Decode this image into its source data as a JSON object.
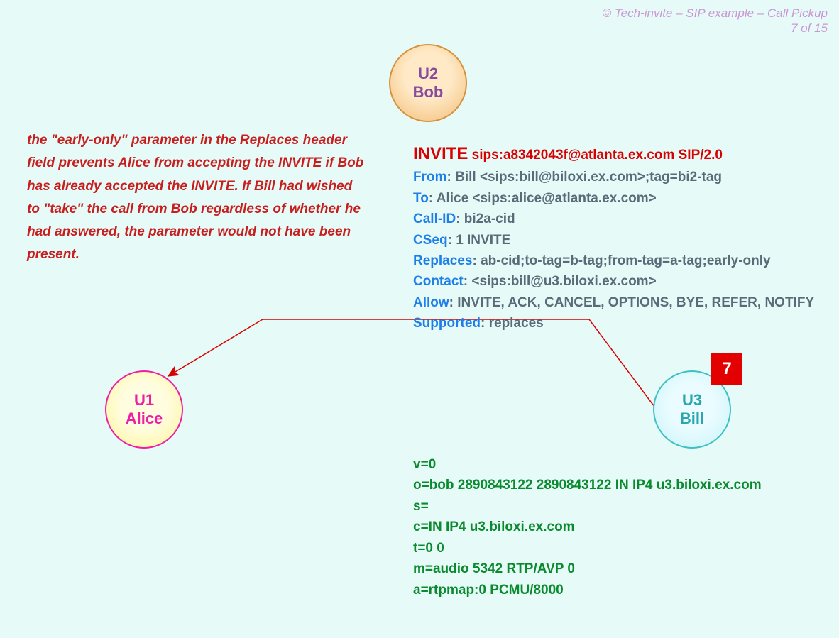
{
  "copyright": {
    "line1": "© Tech-invite – SIP example – Call Pickup",
    "line2": "7 of 15"
  },
  "note": "the \"early-only\" parameter in the Replaces header field prevents Alice from accepting the INVITE if Bob has already accepted the INVITE.  If Bill had wished to \"take\" the call from Bob regardless of whether he had answered, the parameter would not have been present.",
  "nodes": {
    "bob": {
      "ua": "U2",
      "name": "Bob"
    },
    "alice": {
      "ua": "U1",
      "name": "Alice"
    },
    "bill": {
      "ua": "U3",
      "name": "Bill"
    }
  },
  "step": "7",
  "sip": {
    "method": "INVITE",
    "request_uri": "sips:a8342043f@atlanta.ex.com SIP/2.0",
    "headers": {
      "From": {
        "label": "From",
        "value": "Bill <sips:bill@biloxi.ex.com>;tag=bi2-tag"
      },
      "To": {
        "label": "To",
        "value": "Alice <sips:alice@atlanta.ex.com>"
      },
      "CallID": {
        "label": "Call-ID",
        "value": "bi2a-cid"
      },
      "CSeq": {
        "label": "CSeq",
        "value": "1 INVITE"
      },
      "Replaces": {
        "label": "Replaces",
        "value": "ab-cid;to-tag=b-tag;from-tag=a-tag;early-only"
      },
      "Contact": {
        "label": "Contact",
        "value": "<sips:bill@u3.biloxi.ex.com>"
      },
      "Allow": {
        "label": "Allow",
        "value": "INVITE, ACK, CANCEL, OPTIONS, BYE, REFER, NOTIFY"
      },
      "Supported": {
        "label": "Supported",
        "value": "replaces"
      }
    }
  },
  "sdp": {
    "v": "v=0",
    "o": "o=bob  2890843122  2890843122  IN  IP4  u3.biloxi.ex.com",
    "s": "s=",
    "c": "c=IN  IP4  u3.biloxi.ex.com",
    "t": "t=0  0",
    "m": "m=audio  5342  RTP/AVP  0",
    "a": "a=rtpmap:0  PCMU/8000"
  }
}
